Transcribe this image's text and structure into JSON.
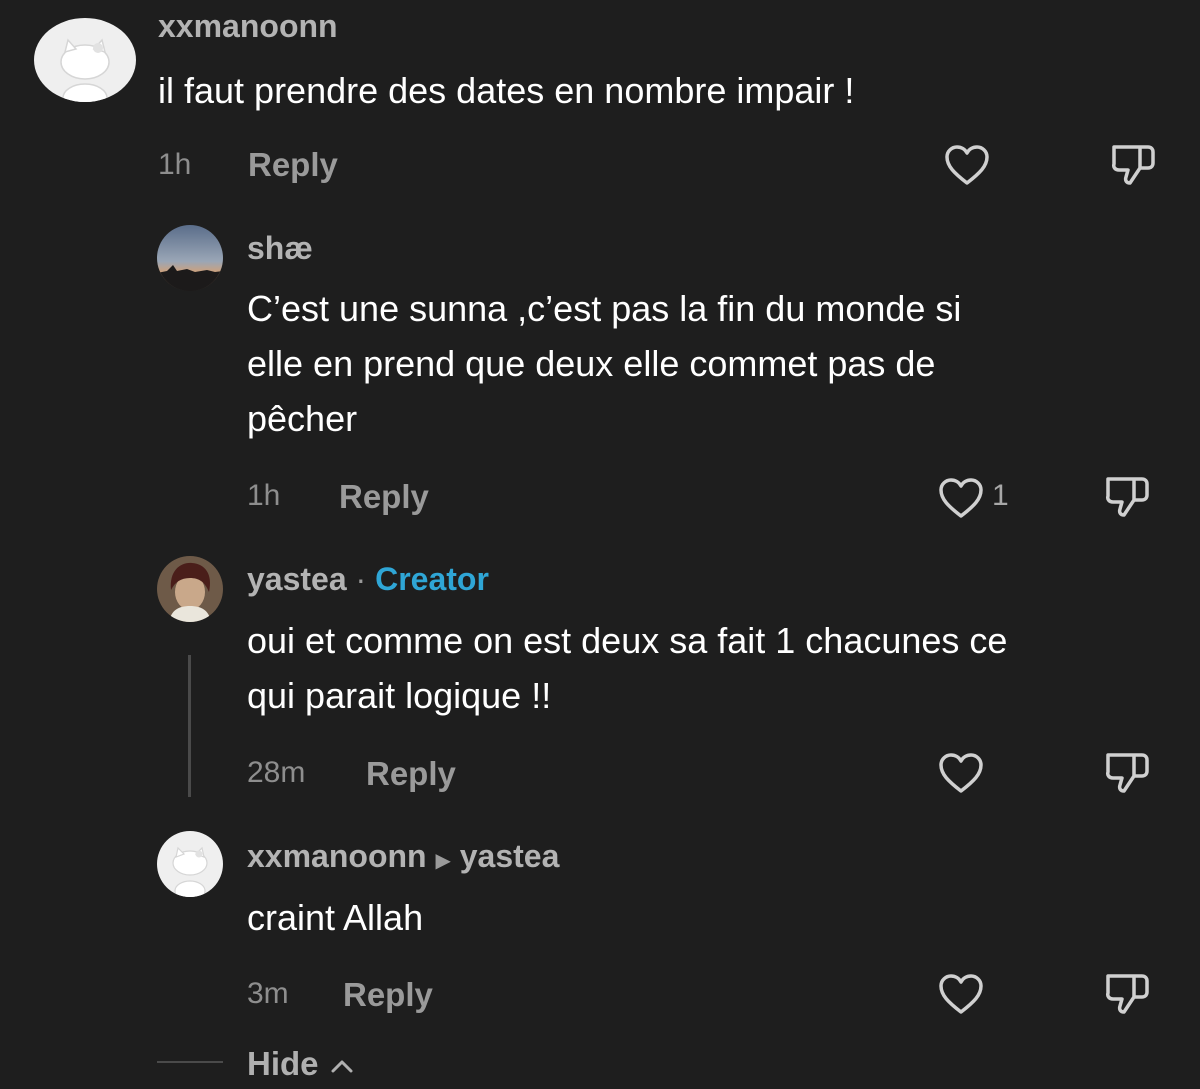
{
  "comments": [
    {
      "username": "xxmanoonn",
      "text": "il faut prendre des dates en nombre impair !",
      "time": "1h",
      "reply_label": "Reply"
    },
    {
      "username": "shæ",
      "text_lines": [
        "C’est une sunna ,c’est pas la fin du monde si",
        "elle en prend que deux elle commet pas de",
        "pêcher"
      ],
      "time": "1h",
      "reply_label": "Reply",
      "like_count": "1"
    },
    {
      "username": "yastea",
      "separator": "·",
      "badge": "Creator",
      "text_lines": [
        "oui et comme on est deux sa fait 1 chacunes ce",
        "qui parait logique !!"
      ],
      "time": "28m",
      "reply_label": "Reply"
    },
    {
      "username": "xxmanoonn",
      "reply_to": "yastea",
      "text": "craint Allah",
      "time": "3m",
      "reply_label": "Reply"
    }
  ],
  "hide_label": "Hide",
  "icons": {
    "like": "heart-outline-icon",
    "dislike": "thumbs-down-outline-icon",
    "reply_arrow": "right-triangle-icon",
    "hide_chevron": "chevron-up-icon"
  },
  "colors": {
    "background": "#1e1e1e",
    "creator_badge": "#2fa6d6"
  }
}
